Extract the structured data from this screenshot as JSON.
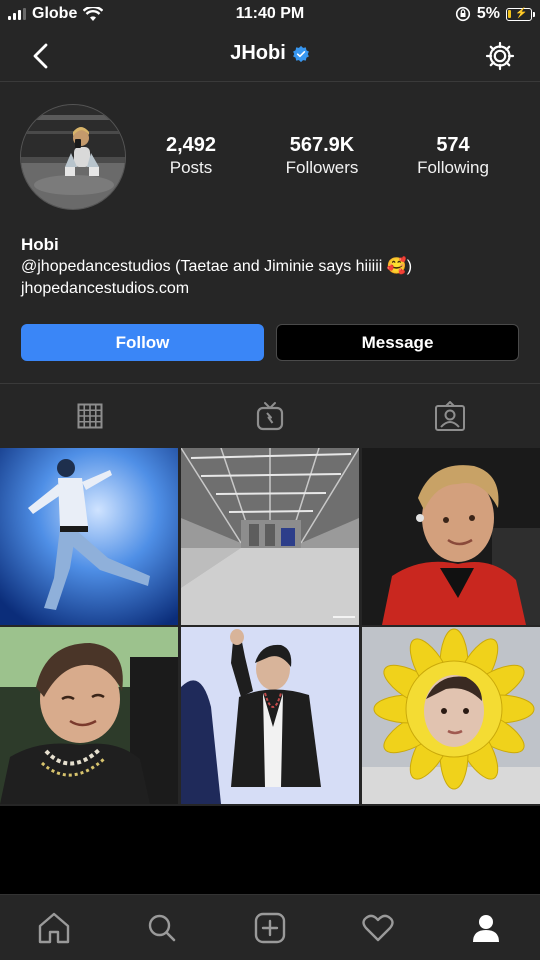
{
  "status_bar": {
    "carrier": "Globe",
    "time": "11:40 PM",
    "battery": "5%"
  },
  "nav": {
    "title": "JHobi",
    "verified": true
  },
  "profile": {
    "stats": [
      {
        "value": "2,492",
        "label": "Posts"
      },
      {
        "value": "567.9K",
        "label": "Followers"
      },
      {
        "value": "574",
        "label": "Following"
      }
    ],
    "name": "Hobi",
    "bio": "@jhopedancestudios (Taetae and Jiminie says hiiiii 🥰)",
    "website": "jhopedancestudios.com"
  },
  "actions": {
    "follow": "Follow",
    "message": "Message"
  },
  "tabs": [
    "grid-icon",
    "igtv-icon",
    "tagged-icon"
  ],
  "posts": [
    {
      "name": "post-dancer-stage"
    },
    {
      "name": "post-dance-studio"
    },
    {
      "name": "post-red-jacket-selfie"
    },
    {
      "name": "post-car-selfie"
    },
    {
      "name": "post-waving-cardigan"
    },
    {
      "name": "post-sunflower-hat"
    }
  ],
  "bottom_nav": [
    "home-icon",
    "search-icon",
    "add-post-icon",
    "activity-heart-icon",
    "profile-icon"
  ],
  "colors": {
    "background": "#262626",
    "follow_button": "#3a86f7",
    "verified_badge": "#3897f0"
  }
}
